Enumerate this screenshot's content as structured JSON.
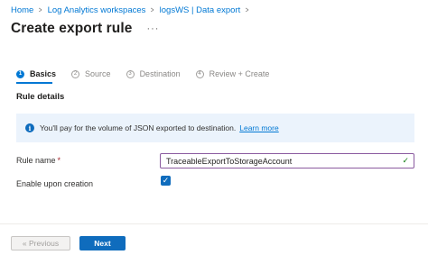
{
  "breadcrumb": {
    "items": [
      "Home",
      "Log Analytics workspaces",
      "logsWS | Data export"
    ],
    "separator": ">"
  },
  "page": {
    "title": "Create export rule",
    "more_icon": "ellipsis-icon",
    "more_label": "···"
  },
  "tabs": [
    {
      "number": "1",
      "label": "Basics",
      "active": true
    },
    {
      "number": "2",
      "label": "Source",
      "active": false
    },
    {
      "number": "3",
      "label": "Destination",
      "active": false
    },
    {
      "number": "4",
      "label": "Review + Create",
      "active": false
    }
  ],
  "section": {
    "title": "Rule details"
  },
  "info": {
    "icon": "info-icon",
    "icon_glyph": "i",
    "text": "You'll pay for the volume of JSON exported to destination.",
    "link": "Learn more"
  },
  "form": {
    "rule_name": {
      "label": "Rule name",
      "required_mark": "*",
      "value": "TraceableExportToStorageAccount",
      "valid_icon": "checkmark-icon"
    },
    "enable": {
      "label": "Enable upon creation",
      "checked": true
    }
  },
  "footer": {
    "previous_label": "« Previous",
    "next_label": "Next"
  },
  "colors": {
    "accent": "#0078d4",
    "banner_bg": "#ebf3fc",
    "field_border": "#8a5a9f",
    "valid": "#107c10"
  }
}
